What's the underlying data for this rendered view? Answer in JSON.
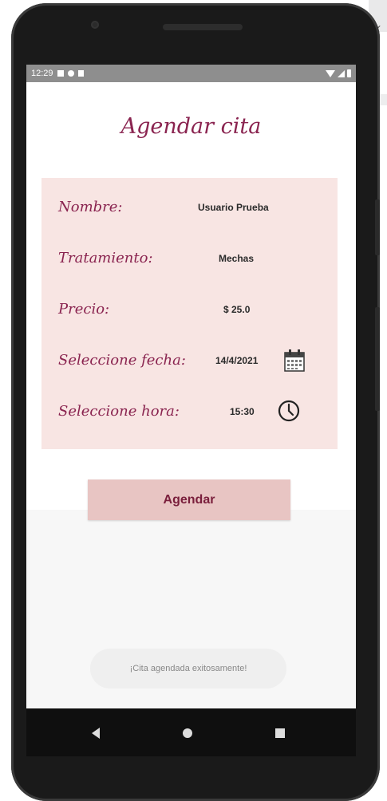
{
  "status_bar": {
    "time": "12:29"
  },
  "app": {
    "title": "Agendar cita",
    "fields": [
      {
        "label": "Nombre:",
        "value": "Usuario Prueba"
      },
      {
        "label": "Tratamiento:",
        "value": "Mechas"
      },
      {
        "label": "Precio:",
        "value": "$ 25.0"
      },
      {
        "label": "Seleccione fecha:",
        "value": "14/4/2021",
        "icon": "calendar-icon"
      },
      {
        "label": "Seleccione hora:",
        "value": "15:30",
        "icon": "clock-icon"
      }
    ],
    "button_label": "Agendar",
    "toast": "¡Cita agendada exitosamente!"
  },
  "colors": {
    "accent": "#8a2450",
    "card_bg": "#f8e5e3",
    "button_bg": "#e8c5c3"
  }
}
